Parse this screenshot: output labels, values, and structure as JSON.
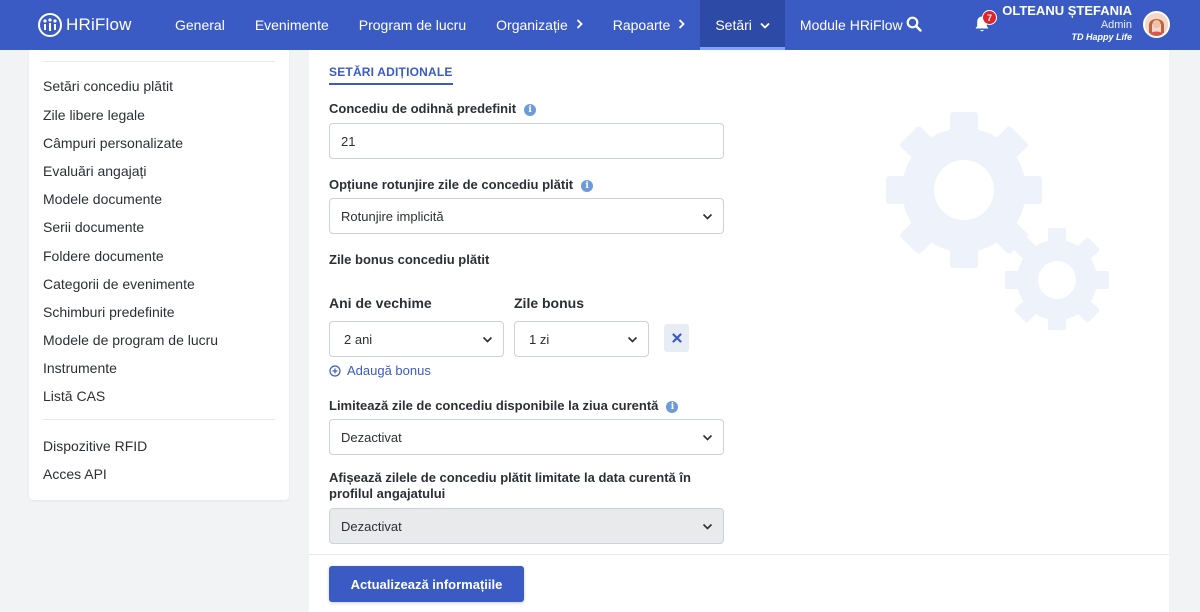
{
  "brand": {
    "name": "HRiFlow"
  },
  "nav": {
    "items": [
      {
        "label": "General"
      },
      {
        "label": "Evenimente"
      },
      {
        "label": "Program de lucru"
      },
      {
        "label": "Organizație"
      },
      {
        "label": "Rapoarte"
      },
      {
        "label": "Setări"
      },
      {
        "label": "Module HRiFlow"
      }
    ],
    "notifications_count": "7"
  },
  "user": {
    "name": "OLTEANU ȘTEFANIA",
    "role": "Admin",
    "company": "TD Happy Life"
  },
  "sidebar": {
    "items": [
      {
        "label": "Setări concediu plătit"
      },
      {
        "label": "Zile libere legale"
      },
      {
        "label": "Câmpuri personalizate"
      },
      {
        "label": "Evaluări angajați"
      },
      {
        "label": "Modele documente"
      },
      {
        "label": "Serii documente"
      },
      {
        "label": "Foldere documente"
      },
      {
        "label": "Categorii de evenimente"
      },
      {
        "label": "Schimburi predefinite"
      },
      {
        "label": "Modele de program de lucru"
      },
      {
        "label": "Instrumente"
      },
      {
        "label": "Listă CAS"
      }
    ],
    "extra_items": [
      {
        "label": "Dispozitive RFID"
      },
      {
        "label": "Acces API"
      }
    ]
  },
  "form": {
    "section_title": "SETĂRI ADIȚIONALE",
    "default_leave": {
      "label": "Concediu de odihnă predefinit",
      "value": "21"
    },
    "rounding": {
      "label": "Opțiune rotunjire zile de concediu plătit",
      "value": "Rotunjire implicită"
    },
    "bonus": {
      "label": "Zile bonus concediu plătit",
      "col_seniority": "Ani de vechime",
      "col_bonus_days": "Zile bonus",
      "rows": [
        {
          "seniority": "2 ani",
          "days": "1 zi"
        }
      ],
      "add_label": "Adaugă bonus"
    },
    "limit_current_day": {
      "label": "Limitează zile de concediu disponibile la ziua curentă",
      "value": "Dezactivat"
    },
    "show_limited": {
      "label": "Afișează zilele de concediu plătit limitate la data curentă în profilul angajatului",
      "value": "Dezactivat"
    },
    "submit_label": "Actualizează informațiile"
  },
  "colors": {
    "primary": "#3a5bc4",
    "badge": "#e0242c",
    "gear_watermark": "#eef2fa"
  }
}
